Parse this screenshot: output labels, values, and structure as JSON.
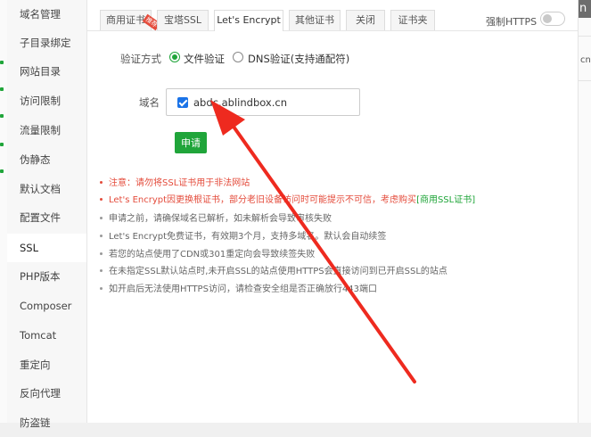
{
  "sidebar": {
    "items": [
      {
        "label": "域名管理",
        "active": false
      },
      {
        "label": "子目录绑定",
        "active": false
      },
      {
        "label": "网站目录",
        "active": false
      },
      {
        "label": "访问限制",
        "active": false
      },
      {
        "label": "流量限制",
        "active": false
      },
      {
        "label": "伪静态",
        "active": false
      },
      {
        "label": "默认文档",
        "active": false
      },
      {
        "label": "配置文件",
        "active": false
      },
      {
        "label": "SSL",
        "active": true
      },
      {
        "label": "PHP版本",
        "active": false
      },
      {
        "label": "Composer",
        "active": false
      },
      {
        "label": "Tomcat",
        "active": false
      },
      {
        "label": "重定向",
        "active": false
      },
      {
        "label": "反向代理",
        "active": false
      },
      {
        "label": "防盗链",
        "active": false
      }
    ]
  },
  "tabs": [
    {
      "label": "商用证书",
      "badge": "推荐",
      "active": false
    },
    {
      "label": "宝塔SSL",
      "active": false
    },
    {
      "label": "Let's Encrypt",
      "active": true
    },
    {
      "label": "其他证书",
      "active": false
    },
    {
      "label": "关闭",
      "active": false
    },
    {
      "label": "证书夹",
      "active": false
    }
  ],
  "force_https": {
    "label": "强制HTTPS",
    "enabled": false
  },
  "verify": {
    "label": "验证方式",
    "options": [
      {
        "label": "文件验证",
        "selected": true
      },
      {
        "label": "DNS验证(支持通配符)",
        "selected": false
      }
    ]
  },
  "domain": {
    "label": "域名",
    "value": "abdc.ablindbox.cn",
    "checked": true
  },
  "apply_button": "申请",
  "notes": [
    {
      "text": "注意：请勿将SSL证书用于非法网站",
      "emphasis": true
    },
    {
      "text": "Let's Encrypt因更换根证书，部分老旧设备访问时可能提示不可信，考虑购买",
      "link": "[商用SSL证书]",
      "emphasis": true
    },
    {
      "text": "申请之前，请确保域名已解析，如未解析会导致审核失败",
      "emphasis": false
    },
    {
      "text": "Let's Encrypt免费证书，有效期3个月，支持多域名。默认会自动续签",
      "emphasis": false
    },
    {
      "text": "若您的站点使用了CDN或301重定向会导致续签失败",
      "emphasis": false
    },
    {
      "text": "在未指定SSL默认站点时,未开启SSL的站点使用HTTPS会直接访问到已开启SSL的站点",
      "emphasis": false
    },
    {
      "text": "如开启后无法使用HTTPS访问，请检查安全组是否正确放行443端口",
      "emphasis": false
    }
  ],
  "background_peek": {
    "right_text": "cn",
    "title_fragment": "n"
  },
  "colors": {
    "accent": "#20a53a",
    "warning": "#e44c3c",
    "checkbox": "#1a73e8",
    "annotation_arrow": "#ee2a1f"
  }
}
